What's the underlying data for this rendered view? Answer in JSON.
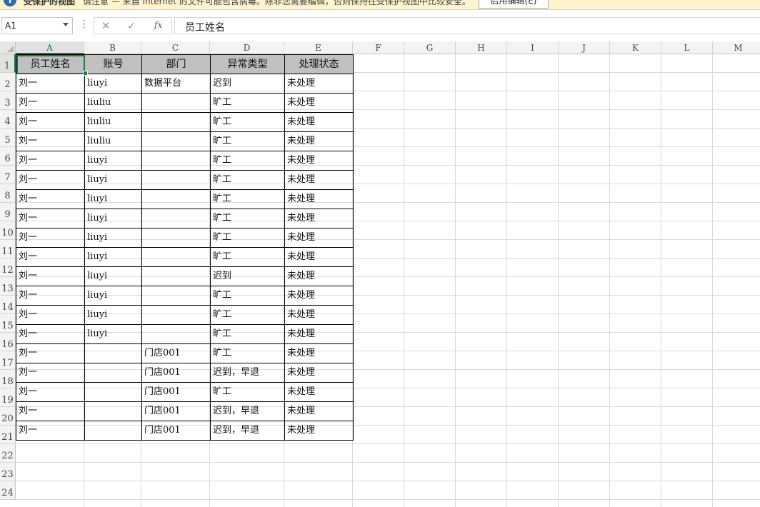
{
  "protected_view": {
    "icon": "i",
    "title": "受保护的视图",
    "message": "请注意 — 来自 Internet 的文件可能包含病毒。除非您需要编辑，否则保持在受保护视图中比较安全。",
    "enable_button": "启用编辑(E)"
  },
  "namebox": {
    "value": "A1"
  },
  "formula_bar": {
    "more_icon": "⋮",
    "cancel_icon": "✕",
    "enter_icon": "✓",
    "fx_label": "fx",
    "content": "员工姓名"
  },
  "columns": [
    "A",
    "B",
    "C",
    "D",
    "E",
    "F",
    "G",
    "H",
    "I",
    "J",
    "K",
    "L",
    "M"
  ],
  "rows": [
    "1",
    "2",
    "3",
    "4",
    "5",
    "6",
    "7",
    "8",
    "9",
    "10",
    "11",
    "12",
    "13",
    "14",
    "15",
    "16",
    "17",
    "18",
    "19",
    "20",
    "21",
    "22",
    "23",
    "24"
  ],
  "table": {
    "headers": [
      "员工姓名",
      "账号",
      "部门",
      "异常类型",
      "处理状态"
    ],
    "rows": [
      [
        "刘一",
        "liuyi",
        "数据平台",
        "迟到",
        "未处理"
      ],
      [
        "刘一",
        "liuliu",
        "",
        "旷工",
        "未处理"
      ],
      [
        "刘一",
        "liuliu",
        "",
        "旷工",
        "未处理"
      ],
      [
        "刘一",
        "liuliu",
        "",
        "旷工",
        "未处理"
      ],
      [
        "刘一",
        "liuyi",
        "",
        "旷工",
        "未处理"
      ],
      [
        "刘一",
        "liuyi",
        "",
        "旷工",
        "未处理"
      ],
      [
        "刘一",
        "liuyi",
        "",
        "旷工",
        "未处理"
      ],
      [
        "刘一",
        "liuyi",
        "",
        "旷工",
        "未处理"
      ],
      [
        "刘一",
        "liuyi",
        "",
        "旷工",
        "未处理"
      ],
      [
        "刘一",
        "liuyi",
        "",
        "旷工",
        "未处理"
      ],
      [
        "刘一",
        "liuyi",
        "",
        "迟到",
        "未处理"
      ],
      [
        "刘一",
        "liuyi",
        "",
        "旷工",
        "未处理"
      ],
      [
        "刘一",
        "liuyi",
        "",
        "旷工",
        "未处理"
      ],
      [
        "刘一",
        "liuyi",
        "",
        "旷工",
        "未处理"
      ],
      [
        "刘一",
        "",
        "门店001",
        "旷工",
        "未处理"
      ],
      [
        "刘一",
        "",
        "门店001",
        "迟到，早退",
        "未处理"
      ],
      [
        "刘一",
        "",
        "门店001",
        "旷工",
        "未处理"
      ],
      [
        "刘一",
        "",
        "门店001",
        "迟到，早退",
        "未处理"
      ],
      [
        "刘一",
        "",
        "门店001",
        "迟到，早退",
        "未处理"
      ]
    ]
  },
  "colors": {
    "accent": "#217346",
    "header_fill": "#c0c0c0",
    "bar_bg": "#fff4ce"
  }
}
